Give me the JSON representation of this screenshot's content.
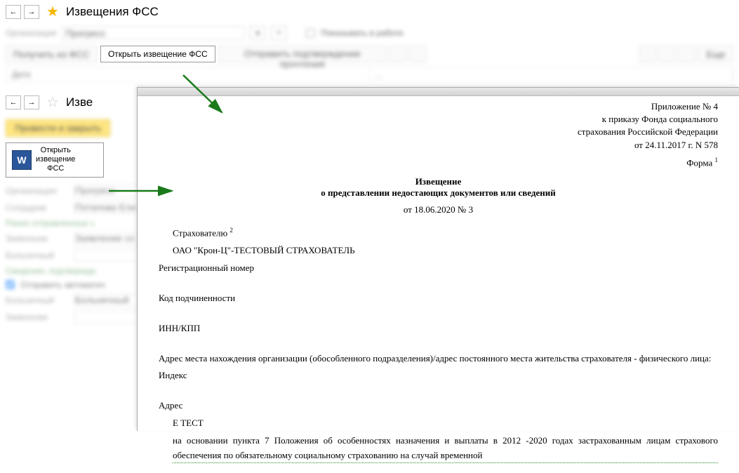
{
  "top": {
    "title": "Извещения ФСС",
    "org_label": "Организация",
    "org_value": "Прогресс",
    "checkbox_label": "Показывать в работе",
    "btn_receive": "Получить из ФСС",
    "btn_open_notice": "Открыть извещение ФСС",
    "btn_send": "Отправить подтверждение прочтения",
    "btn_more": "Еще",
    "col_date": "Дата",
    "col_other": "..."
  },
  "second": {
    "title": "Изве",
    "btn_post_close": "Провести и закрыть",
    "word_btn_line1": "Открыть",
    "word_btn_line2": "извещение",
    "word_btn_line3": "ФСС",
    "org_label": "Организация",
    "org_value": "Прогресс",
    "emp_label": "Сотрудник",
    "emp_value": "Потапова Ели",
    "section1": "Ранее отправленные с",
    "lbl1": "Заявление",
    "val1": "Заявление со",
    "lbl2": "Больничный",
    "section2": "Сведения, подтвержда",
    "chk": "Отправить автоматич",
    "lbl3": "Больничный",
    "val3": "Больничный",
    "lbl4": "Заявление"
  },
  "doc": {
    "appendix": "Приложение № 4",
    "decree_line1": "к приказу Фонда социального",
    "decree_line2": "страхования Российской Федерации",
    "decree_line3": "от 24.11.2017  г. N 578",
    "form": "Форма",
    "form_sup": "1",
    "title": "Извещение",
    "subtitle": "о представлении недостающих документов или сведений",
    "date_line": "от 18.06.2020  № 3",
    "insured_label": "Страхователю",
    "insured_sup": "2",
    "insured_name": "ОАО \"Крон-Ц\"-ТЕСТОВЫЙ СТРАХОВАТЕЛЬ",
    "reg_num_label": "Регистрационный номер",
    "sub_code_label": "Код подчиненности",
    "inn_kpp_label": "ИНН/КПП",
    "address_label": "Адрес места нахождения организации (обособленного подразделения)/адрес постоянного места жительства страхователя - физического лица:",
    "index_label": "Индекс",
    "addr2_label": "Адрес",
    "addr2_value": "Е ТЕСТ",
    "basis": "на основании пункта 7 Положения об особенностях назначения и выплаты в 2012 -2020 годах застрахованным лицам страхового обеспечения по обязательному социальному страхованию на случай временной"
  }
}
